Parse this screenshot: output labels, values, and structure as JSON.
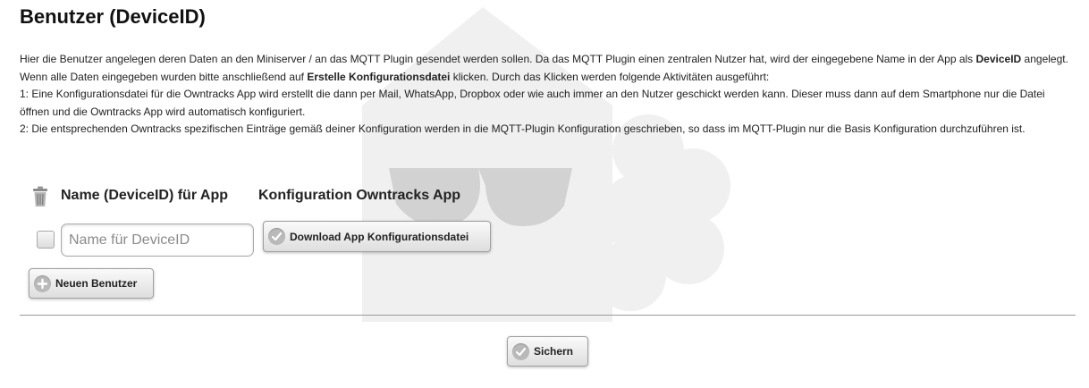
{
  "page": {
    "title": "Benutzer (DeviceID)"
  },
  "intro": {
    "line1_before": "Hier die Benutzer angelegen deren Daten an den Miniserver / an das MQTT Plugin gesendet werden sollen. Da das MQTT Plugin einen zentralen Nutzer hat, wird der eingegebene Name in der App als ",
    "line1_bold": "DeviceID",
    "line1_after": " angelegt.",
    "line2_before": "Wenn alle Daten eingegeben wurden bitte anschließend auf ",
    "line2_bold": "Erstelle Konfigurationsdatei",
    "line2_after": " klicken. Durch das Klicken werden folgende Aktivitäten ausgeführt:",
    "line3": "1: Eine Konfigurationsdatei für die Owntracks App wird erstellt die dann per Mail, WhatsApp, Dropbox oder wie auch immer an den Nutzer geschickt werden kann. Dieser muss dann auf dem Smartphone nur die Datei öffnen und die Owntracks App wird automatisch konfiguriert.",
    "line4": "2: Die entsprechenden Owntracks spezifischen Einträge gemäß deiner Konfiguration werden in die MQTT-Plugin Konfiguration geschrieben, so dass im MQTT-Plugin nur die Basis Konfiguration durchzuführen ist."
  },
  "table": {
    "col_name": "Name (DeviceID) für App",
    "col_config": "Konfiguration Owntracks App",
    "row": {
      "name_value": "",
      "name_placeholder": "Name für DeviceID",
      "download_label": "Download App Konfigurationsdatei"
    }
  },
  "actions": {
    "new_user_label": "Neuen Benutzer",
    "save_label": "Sichern"
  },
  "icons": {
    "delete": "trash-icon",
    "download": "check-circle-icon",
    "new_user": "plus-circle-icon",
    "save": "check-circle-icon"
  }
}
